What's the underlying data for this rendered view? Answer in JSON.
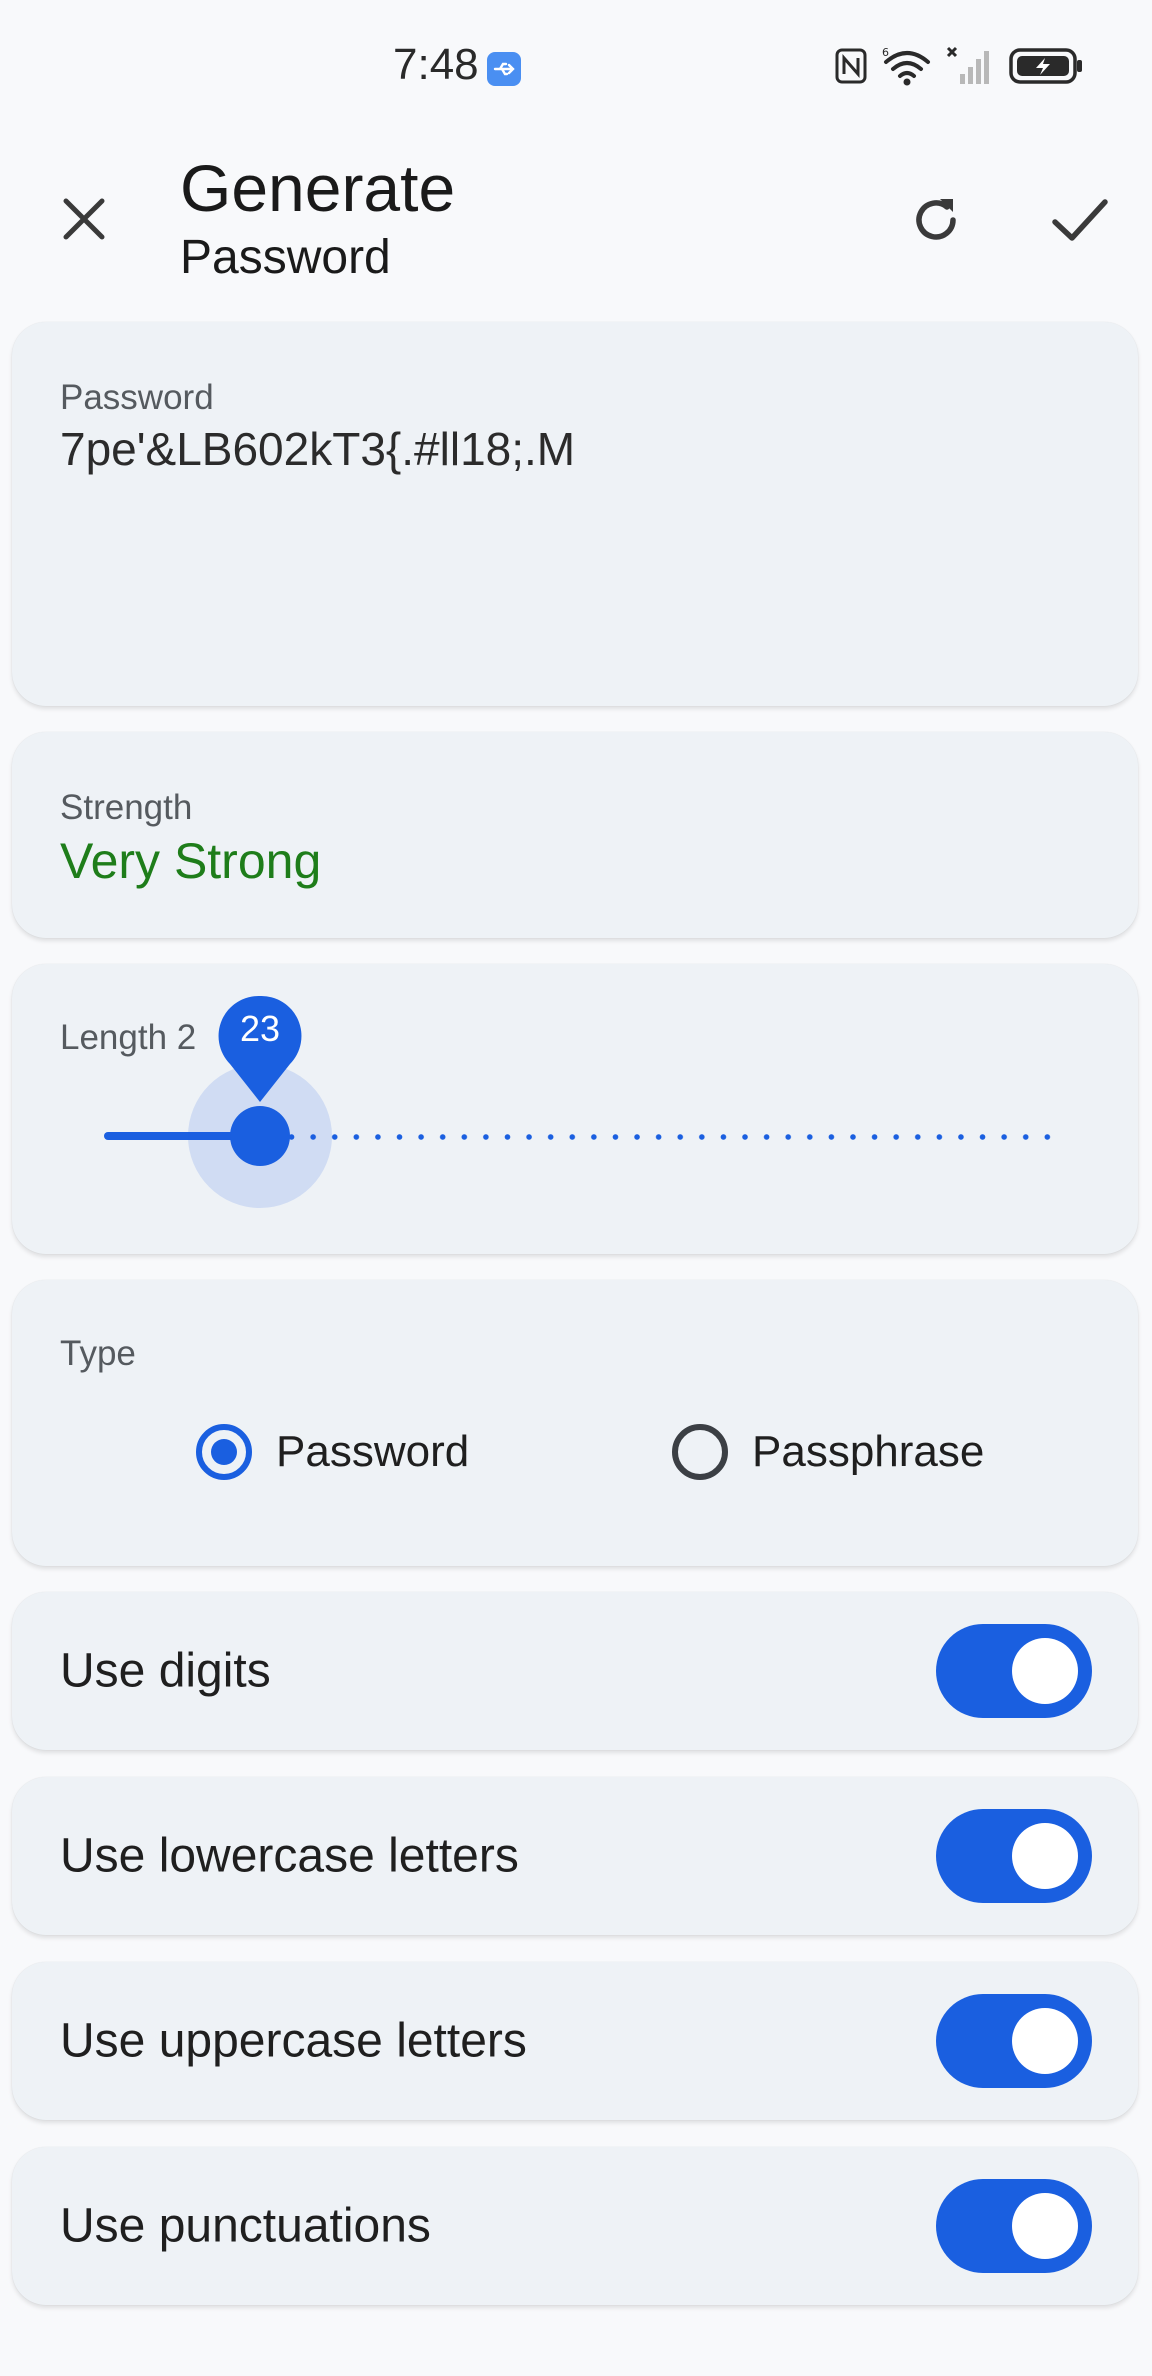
{
  "status_bar": {
    "time": "7:48",
    "icons": [
      "usb-icon",
      "nfc-icon",
      "wifi-6-icon",
      "no-signal-icon",
      "battery-charging-icon"
    ]
  },
  "header": {
    "title": "Generate",
    "subtitle": "Password",
    "close_icon": "close-icon",
    "refresh_icon": "refresh-icon",
    "confirm_icon": "check-icon"
  },
  "password_card": {
    "label": "Password",
    "value": "7pe'&LB602kT3{.#ll18;.M"
  },
  "strength_card": {
    "label": "Strength",
    "value": "Very Strong",
    "color": "#1e7d1a"
  },
  "length_card": {
    "label": "Length 23",
    "visible_label": "Length 2",
    "value": 23,
    "bubble": "23",
    "accent": "#1a5fe0"
  },
  "type_card": {
    "label": "Type",
    "options": [
      {
        "label": "Password",
        "selected": true
      },
      {
        "label": "Passphrase",
        "selected": false
      }
    ]
  },
  "options": [
    {
      "label": "Use digits",
      "enabled": true
    },
    {
      "label": "Use lowercase letters",
      "enabled": true
    },
    {
      "label": "Use uppercase letters",
      "enabled": true
    },
    {
      "label": "Use punctuations",
      "enabled": true
    }
  ],
  "colors": {
    "accent": "#1a5fe0",
    "card_background": "#eef2f6",
    "page_background": "#f8f9fb"
  }
}
